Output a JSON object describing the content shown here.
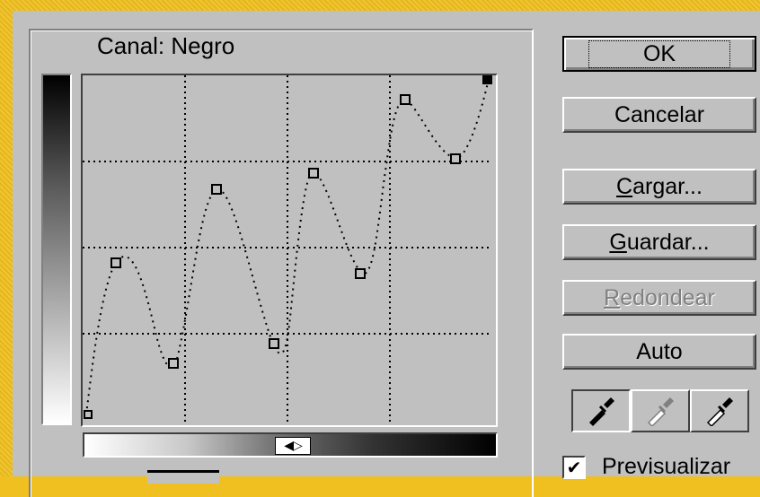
{
  "dialog": {
    "channel_label": "Canal:  Negro"
  },
  "buttons": {
    "ok": "OK",
    "cancel": "Cancelar",
    "load_prefix": "C",
    "load_rest": "argar...",
    "save_prefix": "G",
    "save_rest": "uardar...",
    "smooth_prefix": "R",
    "smooth_rest": "edondear",
    "auto": "Auto"
  },
  "preview": {
    "label": "Previsualizar",
    "checked": "✔"
  },
  "eyedroppers": [
    "black-eyedropper-icon",
    "gray-eyedropper-icon",
    "white-eyedropper-icon"
  ],
  "colors": {
    "frame": "#f0c020",
    "panel": "#c0c0c0"
  }
}
